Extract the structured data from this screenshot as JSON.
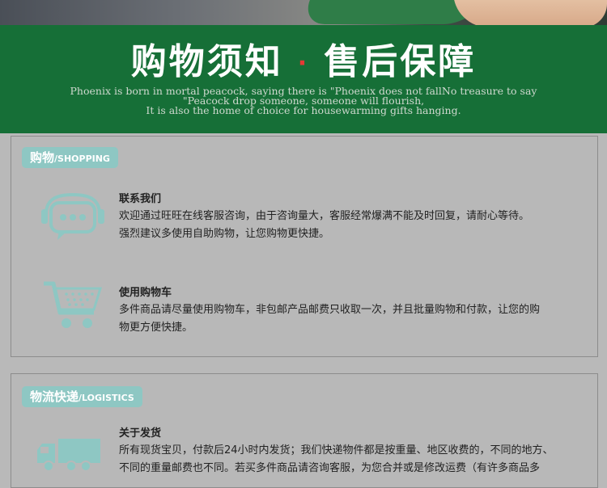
{
  "banner": {
    "title_left": "购物须知",
    "separator": "·",
    "title_right": "售后保障",
    "subtitle_lines": [
      "Phoenix is born in mortal peacock, saying there is \"Phoenix does not fallNo treasure to say",
      "\"Peacock drop someone, someone will flourish,",
      "It is also the home of choice for housewarming gifts hanging."
    ]
  },
  "shopping": {
    "badge_cn": "购物",
    "badge_en": "/SHOPPING",
    "items": [
      {
        "icon": "chat-support-icon",
        "title": "联系我们",
        "lines": [
          "欢迎通过旺旺在线客服咨询，由于咨询量大，客服经常爆满不能及时回复，请耐心等待。",
          "强烈建议多使用自助购物，让您购物更快捷。"
        ]
      },
      {
        "icon": "shopping-cart-icon",
        "title": "使用购物车",
        "lines": [
          "多件商品请尽量使用购物车，非包邮产品邮费只收取一次，并且批量购物和付款，让您的购",
          "物更方便快捷。"
        ]
      }
    ]
  },
  "logistics": {
    "badge_cn": "物流快递",
    "badge_en": "/LOGISTICS",
    "items": [
      {
        "icon": "delivery-truck-icon",
        "title": "关于发货",
        "lines": [
          "所有现货宝贝，付款后24小时内发货；我们快递物件都是按重量、地区收费的，不同的地方、",
          "不同的重量邮费也不同。若买多件商品请咨询客服，为您合并或是修改运费（有许多商品多"
        ]
      }
    ]
  },
  "colors": {
    "banner_green": "#166f37",
    "accent_teal": "#8ec7c3",
    "separator_red": "#e53935",
    "background_gray": "#b9b9b9"
  }
}
